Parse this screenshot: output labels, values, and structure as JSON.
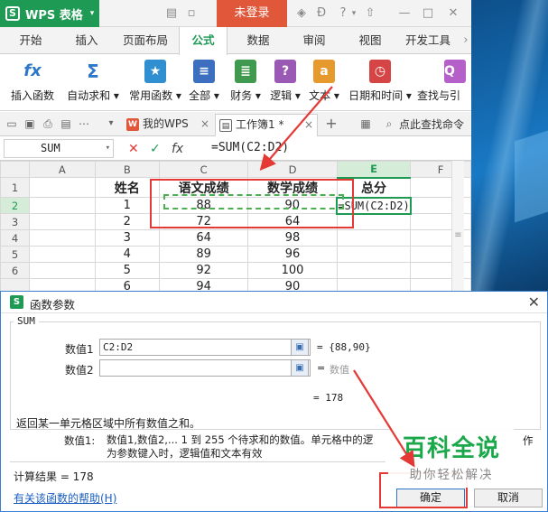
{
  "titlebar": {
    "app_name": "WPS 表格",
    "login_label": "未登录"
  },
  "ribbon_tabs": [
    {
      "label": "开始"
    },
    {
      "label": "插入"
    },
    {
      "label": "页面布局"
    },
    {
      "label": "公式"
    },
    {
      "label": "数据"
    },
    {
      "label": "审阅"
    },
    {
      "label": "视图"
    },
    {
      "label": "开发工具"
    }
  ],
  "active_tab": "公式",
  "ribbon_groups": [
    {
      "label": "插入函数",
      "icon": "fx-icon",
      "glyph": "fx"
    },
    {
      "label": "自动求和 ▾",
      "icon": "sigma-icon",
      "glyph": "Σ"
    },
    {
      "label": "常用函数 ▾",
      "icon": "star-book-icon",
      "glyph": "★"
    },
    {
      "label": "全部 ▾",
      "icon": "list-book-icon",
      "glyph": "≡"
    },
    {
      "label": "财务 ▾",
      "icon": "finance-book-icon",
      "glyph": "≣"
    },
    {
      "label": "逻辑 ▾",
      "icon": "logic-book-icon",
      "glyph": "?"
    },
    {
      "label": "文本 ▾",
      "icon": "text-book-icon",
      "glyph": "a"
    },
    {
      "label": "日期和时间 ▾",
      "icon": "clock-icon",
      "glyph": "◷"
    },
    {
      "label": "查找与引",
      "icon": "lookup-book-icon",
      "glyph": "Q"
    }
  ],
  "doc_tabs": {
    "wps_tab": "我的WPS",
    "workbook_tab": "工作簿1 *",
    "search_placeholder": "点此查找命令"
  },
  "formula_bar": {
    "name_box": "SUM",
    "formula": "=SUM(C2:D2)"
  },
  "sheet": {
    "columns": [
      "A",
      "B",
      "C",
      "D",
      "E",
      "F"
    ],
    "row_numbers": [
      "1",
      "2",
      "3",
      "4",
      "5",
      "6"
    ],
    "header_row": [
      "",
      "姓名",
      "语文成绩",
      "数学成绩",
      "总分",
      ""
    ],
    "rows": [
      [
        "",
        "1",
        "88",
        "90",
        "=SUM(C2:D2)",
        ""
      ],
      [
        "",
        "2",
        "72",
        "64",
        "",
        ""
      ],
      [
        "",
        "3",
        "64",
        "98",
        "",
        ""
      ],
      [
        "",
        "4",
        "89",
        "96",
        "",
        ""
      ],
      [
        "",
        "5",
        "92",
        "100",
        "",
        ""
      ],
      [
        "",
        "6",
        "94",
        "90",
        "",
        ""
      ]
    ]
  },
  "dialog": {
    "title": "函数参数",
    "function_name": "SUM",
    "arg1_label": "数值1",
    "arg1_value": "C2:D2",
    "arg1_result": "= {88,90}",
    "arg2_label": "数值2",
    "arg2_value": "",
    "arg2_result_eq": "=",
    "arg2_result": "数值",
    "function_result": "= 178",
    "description": "返回某一单元格区域中所有数值之和。",
    "arg_desc_key": "数值1:",
    "arg_desc_line1": "数值1,数值2,... 1 到 255 个待求和的数值。单元格中的逻",
    "arg_desc_line1_tail": "作",
    "arg_desc_line2": "为参数键入时，逻辑值和文本有效",
    "calc_result": "计算结果 = 178",
    "help_link": "有关该函数的帮助(H)",
    "ok_label": "确定",
    "cancel_label": "取消"
  },
  "watermark": {
    "main": "百科全说",
    "sub": "助你轻松解决"
  },
  "colors": {
    "wps_green": "#1e9a55",
    "login_orange": "#e0573a",
    "annotation_red": "#e53935",
    "selection_dash": "#4caf50",
    "dialog_border": "#3c7fd1"
  }
}
